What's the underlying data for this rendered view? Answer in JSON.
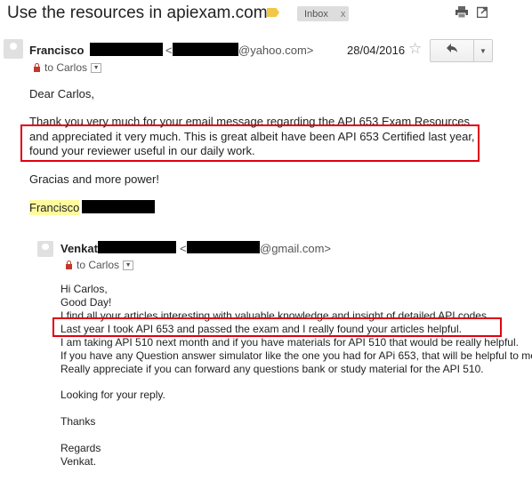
{
  "subject": "Use the resources in apiexam.com",
  "label_badge": "Inbox",
  "label_badge_close": "x",
  "icons": {
    "print": "print-icon",
    "newwindow": "new-window-icon",
    "star": "star-icon",
    "reply": "reply-icon",
    "more": "more-dropdown-icon",
    "lock": "lock-icon",
    "label": "label-tag-icon"
  },
  "outer": {
    "sender_name": "Francisco",
    "email_open": "<",
    "email_domain": "@yahoo.com>",
    "date": "28/04/2016",
    "to_line": "to Carlos",
    "greeting": "Dear Carlos,",
    "body_lines": [
      "Thank you very much for your email message regarding the API 653 Exam Resources",
      "and appreciated it very much. This is great albeit have been API 653 Certified last year,",
      "found your reviewer useful in our daily work."
    ],
    "closing": "Gracias and more power!",
    "signature": "Francisco"
  },
  "quoted": {
    "sender_name": "Venkat",
    "email_open": "<",
    "email_domain": "@gmail.com>",
    "to_line": "to Carlos",
    "lines": [
      "Hi Carlos,",
      "Good Day!",
      "I find all your articles interesting with valuable knowledge and insight of detailed API codes.",
      "Last year I took API 653 and passed the exam and I really found your articles helpful.",
      "I am taking API 510 next month and if you have materials for API 510 that would be really helpful.",
      "If you have any Question answer simulator like the one you had for APi 653, that will be helpful to me.",
      "Really appreciate if you can forward any questions bank or study material for the API 510."
    ],
    "looking": "Looking for your reply.",
    "thanks": "Thanks",
    "regards": "Regards",
    "name": "Venkat."
  },
  "colors": {
    "highlight_box": "#e0000e",
    "signature_highlight": "#fffa9e",
    "label_tag": "#f2c744"
  }
}
